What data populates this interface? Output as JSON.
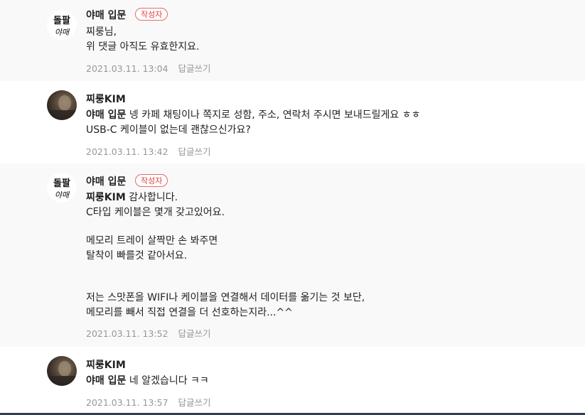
{
  "comments": [
    {
      "author": "야매 입문",
      "badge": "작성자",
      "mention": "",
      "lines": [
        "찌룽님,",
        "위 댓글 아직도 유효한지요."
      ],
      "date": "2021.03.11. 13:04",
      "reply_label": "답글쓰기",
      "avatar": "channel-logo"
    },
    {
      "author": "찌룽KIM",
      "mention": "야매 입문",
      "first_line_rest": " 넹 카페 채팅이나 쪽지로 성함, 주소, 연락처 주시면 보내드릴게요 ㅎㅎ",
      "lines": [
        "USB-C 케이블이 없는데 괜찮으신가요?"
      ],
      "date": "2021.03.11. 13:42",
      "reply_label": "답글쓰기",
      "avatar": "user-photo"
    },
    {
      "author": "야매 입문",
      "badge": "작성자",
      "mention": "찌룽KIM",
      "first_line_rest": " 감사합니다.",
      "lines": [
        "C타입 케이블은 몇개 갖고있어요.",
        "",
        "메모리 트레이 살짝만 손 봐주면",
        "탈착이 빠를것 같아서요.",
        "",
        "",
        "저는 스맛폰을 WIFI나 케이블을 연결해서 데이터를 옮기는 것 보단,",
        "메모리를 빼서 직접 연결을 더 선호하는지라...^^"
      ],
      "date": "2021.03.11. 13:52",
      "reply_label": "답글쓰기",
      "avatar": "channel-logo"
    },
    {
      "author": "찌룽KIM",
      "mention": "야매 입문",
      "first_line_rest": " 네 알겠습니다 ㅋㅋ",
      "lines": [],
      "date": "2021.03.11. 13:57",
      "reply_label": "답글쓰기",
      "avatar": "user-photo"
    }
  ],
  "logo": {
    "line1": "돌팔",
    "line2": "야매"
  },
  "colors": {
    "badge": "#e0403f",
    "meta": "#979797",
    "bg_alt": "#f9f9f9"
  }
}
